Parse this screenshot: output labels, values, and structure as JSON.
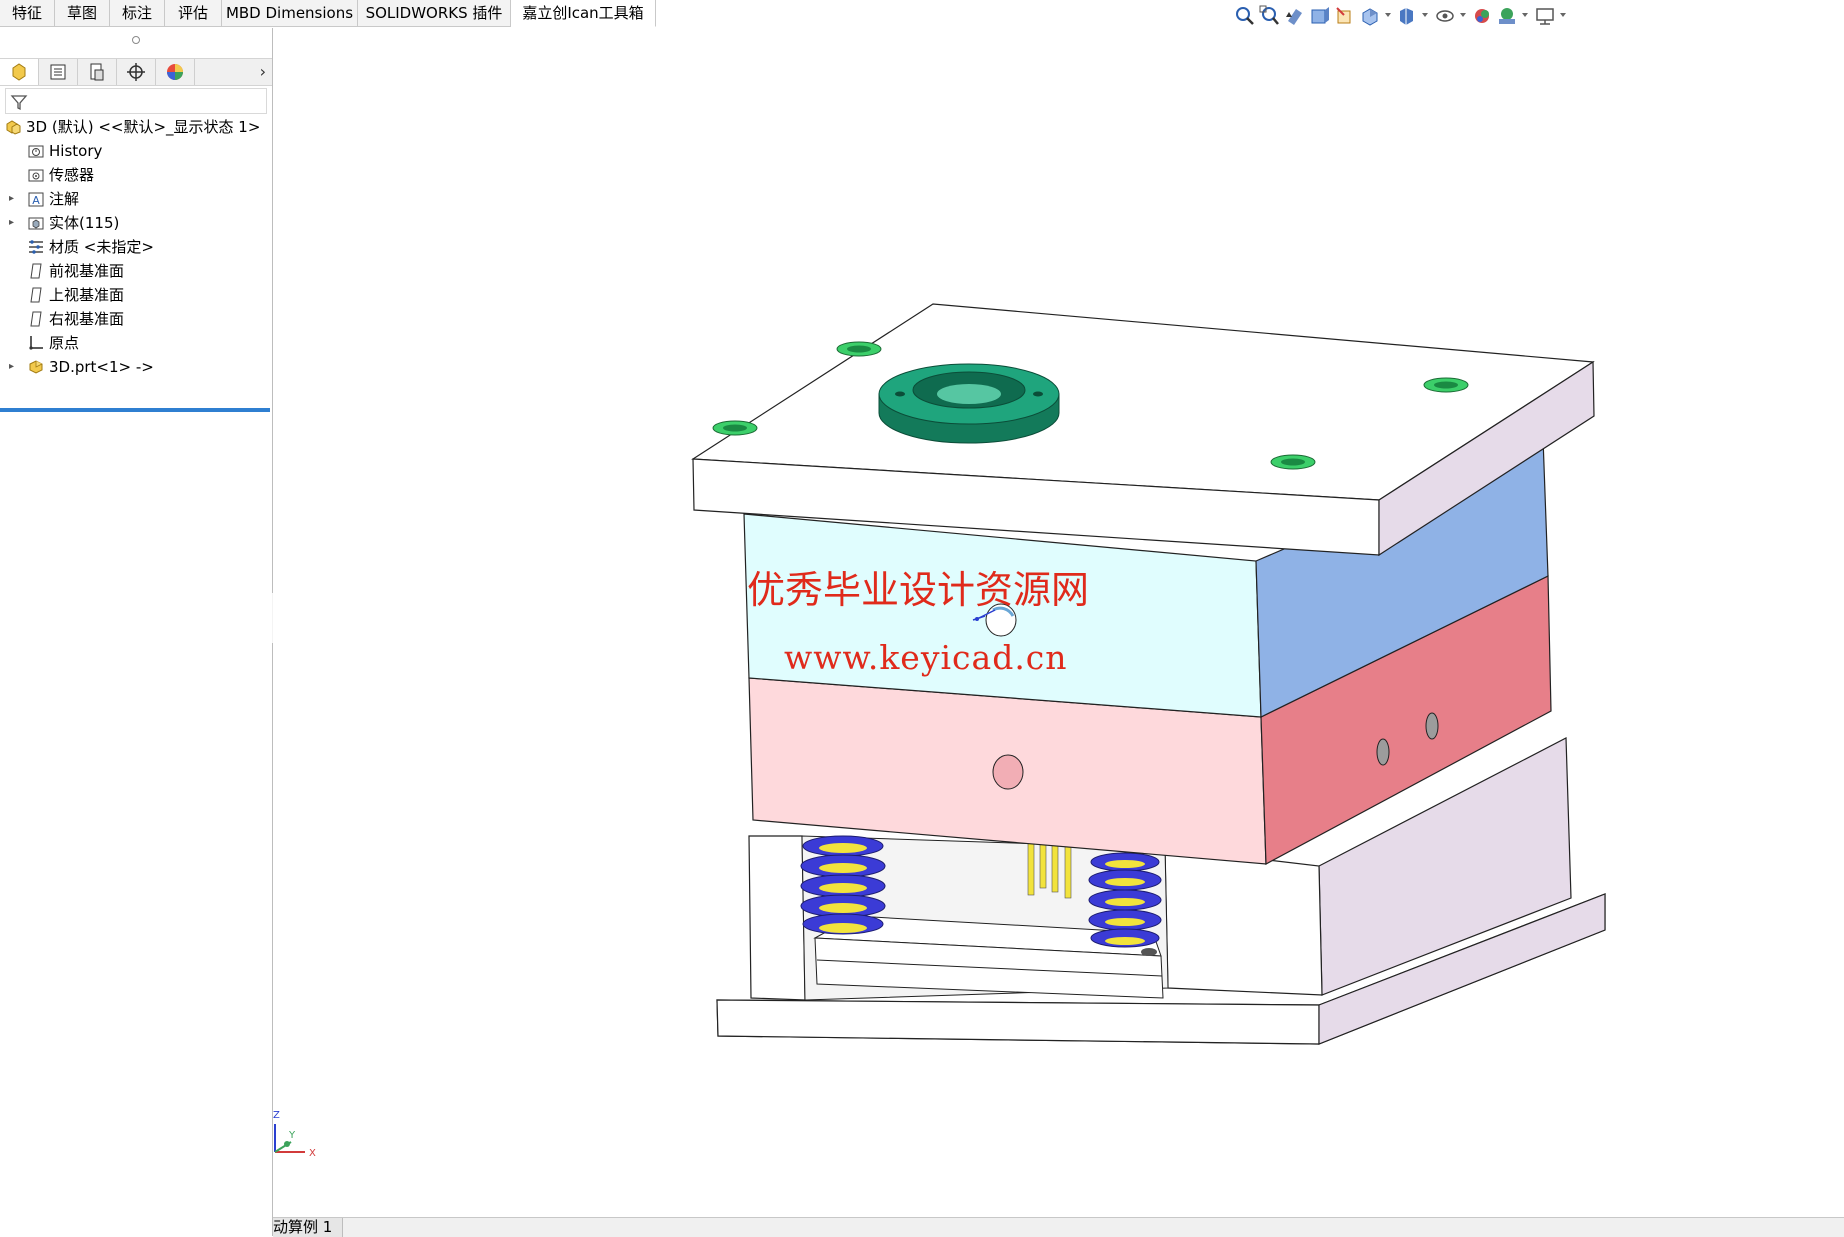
{
  "command_tabs": [
    {
      "label": "特征"
    },
    {
      "label": "草图"
    },
    {
      "label": "标注"
    },
    {
      "label": "评估"
    },
    {
      "label": "MBD Dimensions"
    },
    {
      "label": "SOLIDWORKS 插件"
    },
    {
      "label": "嘉立创Ican工具箱"
    }
  ],
  "view_toolbar": {
    "icons": [
      "zoom-to-fit-icon",
      "zoom-to-area-icon",
      "previous-view-icon",
      "section-view-icon",
      "dynamic-annotation-icon",
      "view-orientation-icon",
      "display-style-icon",
      "hide-show-items-icon",
      "edit-appearance-icon",
      "apply-scene-icon",
      "view-settings-icon"
    ]
  },
  "feature_manager": {
    "panel_tabs": [
      "featuremanager-tab",
      "propertymanager-tab",
      "configurationmanager-tab",
      "dimxpert-tab",
      "displaymanager-tab"
    ],
    "more_glyph": "›",
    "filter_icon": "filter-icon",
    "tree": [
      {
        "label": "3D (默认) <<默认>_显示状态 1>",
        "icon": "assembly-icon",
        "expander": ""
      },
      {
        "label": "History",
        "icon": "history-icon",
        "expander": ""
      },
      {
        "label": "传感器",
        "icon": "sensor-folder-icon",
        "expander": ""
      },
      {
        "label": "注解",
        "icon": "annotations-icon",
        "expander": "▸"
      },
      {
        "label": "实体(115)",
        "icon": "solid-bodies-icon",
        "expander": "▸"
      },
      {
        "label": "材质 <未指定>",
        "icon": "material-icon",
        "expander": ""
      },
      {
        "label": "前视基准面",
        "icon": "plane-icon",
        "expander": ""
      },
      {
        "label": "上视基准面",
        "icon": "plane-icon",
        "expander": ""
      },
      {
        "label": "右视基准面",
        "icon": "plane-icon",
        "expander": ""
      },
      {
        "label": "原点",
        "icon": "origin-icon",
        "expander": ""
      },
      {
        "label": "3D.prt<1> ->",
        "icon": "part-icon",
        "expander": "▸"
      }
    ]
  },
  "graphics": {
    "watermark_title": "优秀毕业设计资源网",
    "watermark_url": "www.keyicad.cn",
    "triad": {
      "z": "Z",
      "y": "Y",
      "x": "X"
    },
    "colors": {
      "top_plate": "#ffffff",
      "cavity_front": "#e0fdfe",
      "cavity_side": "#8fb2e6",
      "core_front": "#fed9dc",
      "core_side": "#e77f89",
      "lower_side": "#e6dbe9",
      "locating_ring": "#1fa57d",
      "spring_blue": "#3b3bd6",
      "spring_yellow": "#f2e33c"
    }
  },
  "bottom_bar": {
    "motion_tab": "动算例 1"
  }
}
